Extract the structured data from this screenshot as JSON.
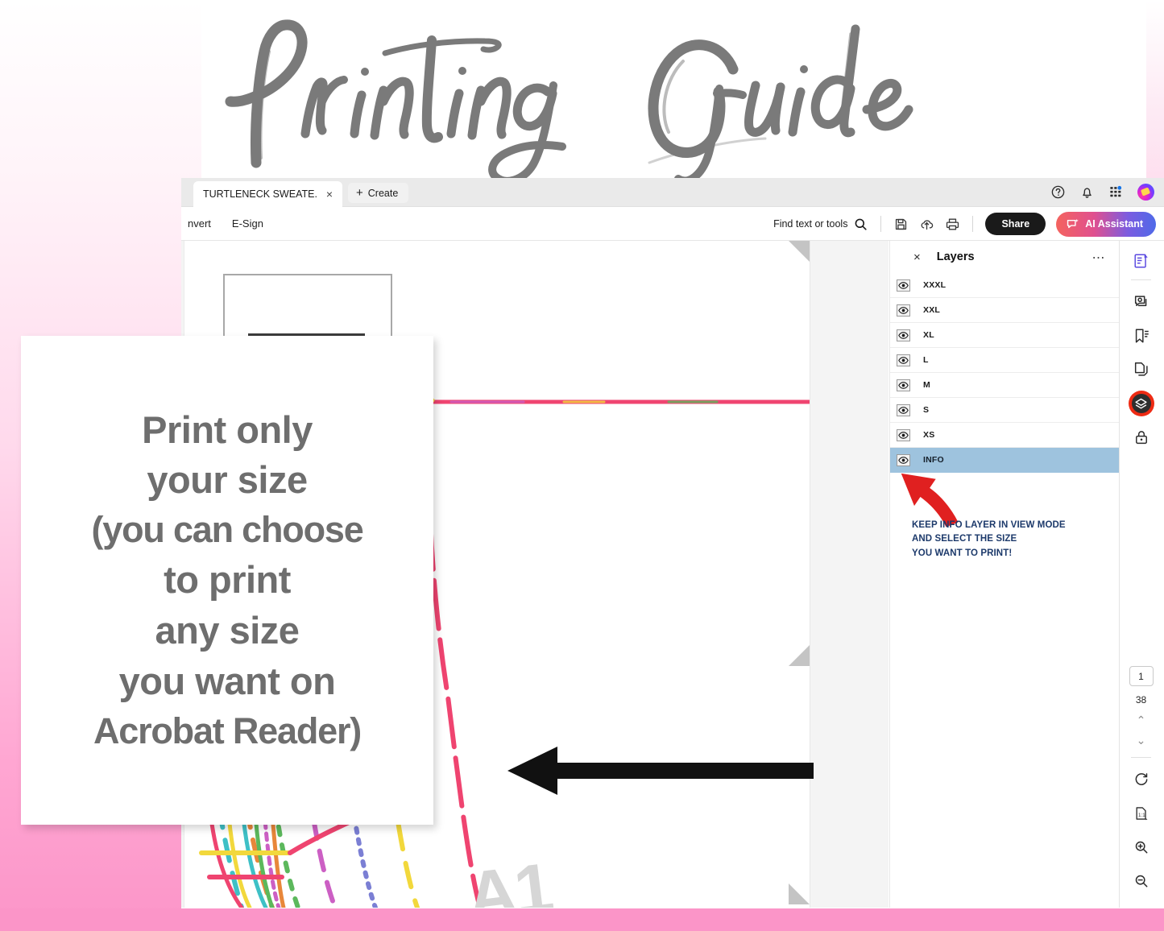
{
  "poster": {
    "title": "Printing Guide",
    "accent_pink": "#fb95c8",
    "title_color": "#777777"
  },
  "callout": {
    "lines": [
      "Print only",
      "your size",
      "(you can choose",
      "to print",
      "any size",
      "you want on",
      "Acrobat Reader)"
    ]
  },
  "app": {
    "tab": {
      "title": "TURTLENECK SWEATE...",
      "close_label": "×",
      "create_label": "Create",
      "plus": "+"
    },
    "titlebar_icons": [
      {
        "name": "help-icon",
        "glyph": "?"
      },
      {
        "name": "notifications-icon",
        "glyph": "bell"
      },
      {
        "name": "apps-grid-icon",
        "glyph": "grid"
      },
      {
        "name": "user-avatar",
        "glyph": "avatar"
      }
    ],
    "menu": {
      "items": [
        "nvert",
        "E-Sign"
      ],
      "find_placeholder": "Find text or tools",
      "save_icon": "save-icon",
      "upload_icon": "cloud-upload-icon",
      "print_icon": "print-icon",
      "share_label": "Share",
      "ai_label": "AI Assistant"
    }
  },
  "layers_panel": {
    "title": "Layers",
    "close_label": "×",
    "more_label": "⋯",
    "items": [
      {
        "name": "XXXL",
        "selected": false
      },
      {
        "name": "XXL",
        "selected": false
      },
      {
        "name": "XL",
        "selected": false
      },
      {
        "name": "L",
        "selected": false
      },
      {
        "name": "M",
        "selected": false
      },
      {
        "name": "S",
        "selected": false
      },
      {
        "name": "XS",
        "selected": false
      },
      {
        "name": "INFO",
        "selected": true
      }
    ],
    "selected_color": "#9ec3de",
    "note": "KEEP INFO LAYER IN VIEW MODE\nAND SELECT THE SIZE\nYOU WANT TO PRINT!",
    "note_color": "#1d3a6b",
    "arrow_color": "#e02020"
  },
  "right_rail": {
    "icons": [
      {
        "name": "edit-pdf-icon",
        "active": false
      },
      {
        "name": "comment-icon",
        "active": false
      },
      {
        "name": "bookmark-icon",
        "active": false
      },
      {
        "name": "organize-pages-icon",
        "active": false
      },
      {
        "name": "layers-icon",
        "active": true
      },
      {
        "name": "protect-lock-icon",
        "active": false
      }
    ],
    "page_current": "1",
    "page_total": "38",
    "nav_up": "⌃",
    "nav_down": "⌄",
    "tools": [
      {
        "name": "rotate-icon"
      },
      {
        "name": "fit-page-icon"
      },
      {
        "name": "zoom-in-icon"
      },
      {
        "name": "zoom-out-icon"
      }
    ]
  },
  "document": {
    "size_mark": "A1",
    "size_mark_color": "#d6d6d6",
    "pattern_colors": {
      "teal": "#3ec0c6",
      "orange": "#e8873a",
      "green": "#5cb85c",
      "magenta": "#cc5fc4",
      "blueviolet": "#7b7fd4",
      "yellow": "#f2d83c",
      "pink": "#ef4470"
    },
    "arrow_color": "#111111"
  }
}
